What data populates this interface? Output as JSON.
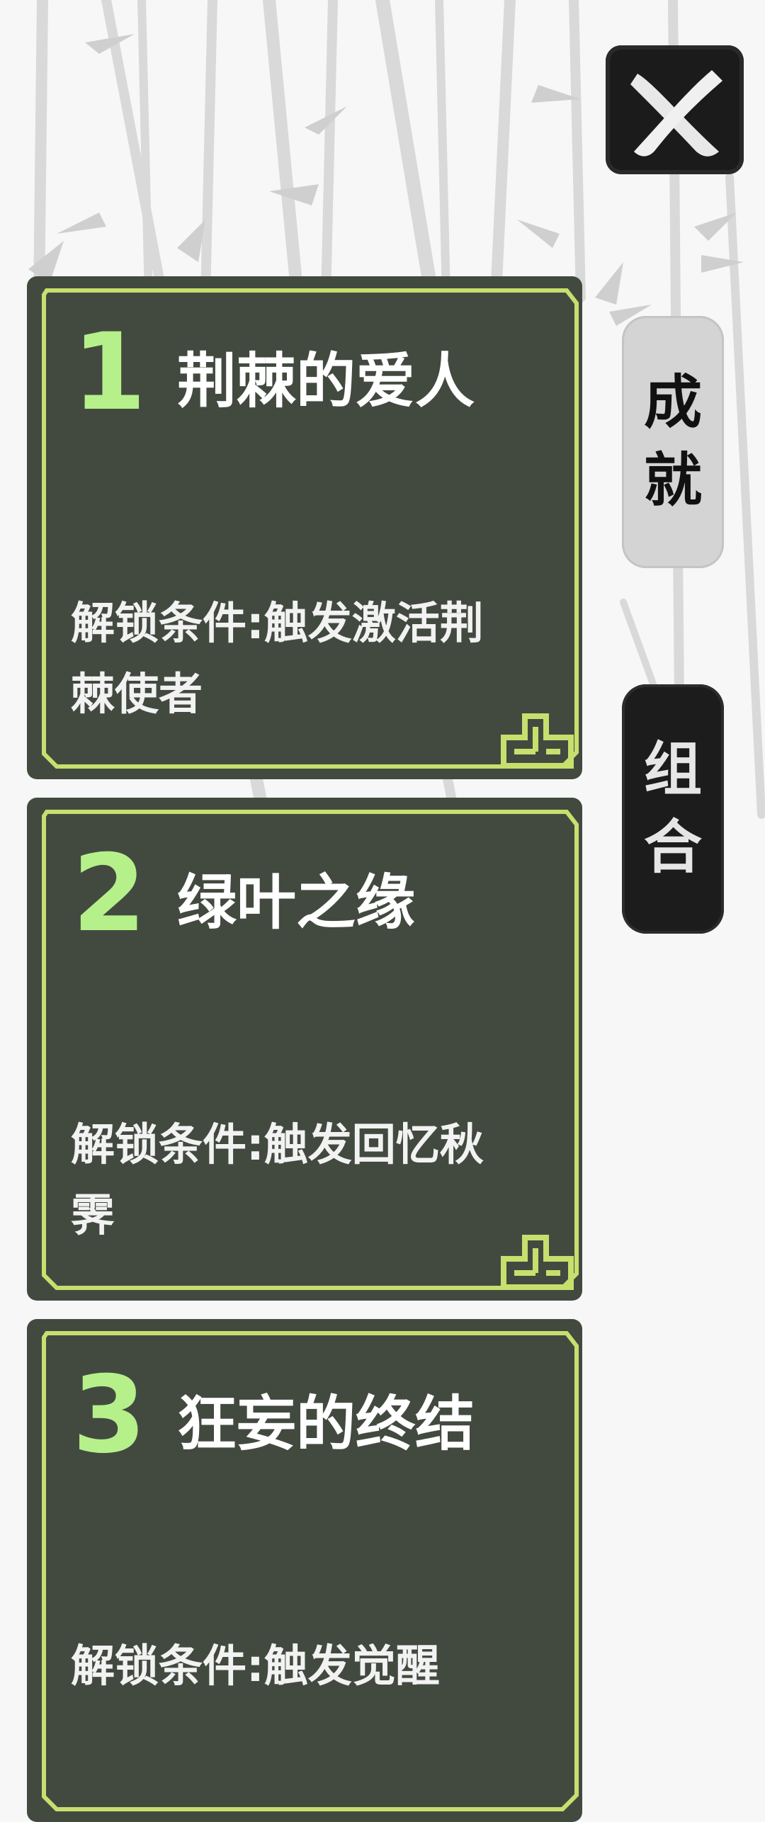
{
  "close_button": {
    "icon": "brush-x-icon"
  },
  "tabs": [
    {
      "label_line1": "成",
      "label_line2": "就",
      "active": true
    },
    {
      "label_line1": "组",
      "label_line2": "合",
      "active": false
    }
  ],
  "colors": {
    "card_bg": "#424a40",
    "frame": "#c8df6e",
    "number": "#b6f08a",
    "title": "#ffffff"
  },
  "achievements": [
    {
      "number": "1",
      "title": "荆棘的爱人",
      "condition": "解锁条件:触发激活荆棘使者"
    },
    {
      "number": "2",
      "title": "绿叶之缘",
      "condition": "解锁条件:触发回忆秋霁"
    },
    {
      "number": "3",
      "title": "狂妄的终结",
      "condition": "解锁条件:触发觉醒"
    }
  ]
}
